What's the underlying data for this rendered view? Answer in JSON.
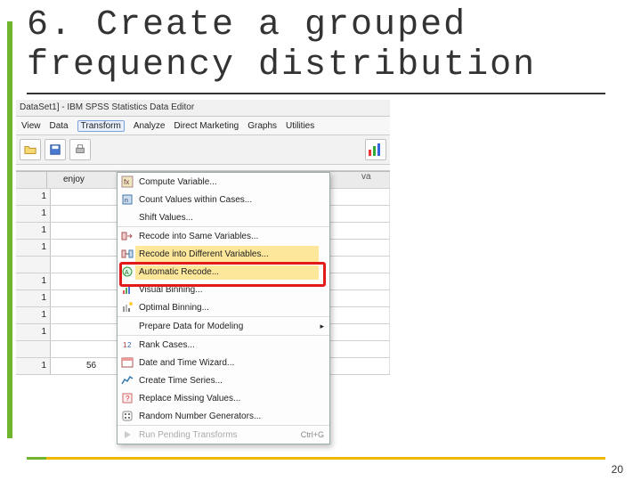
{
  "title": "6. Create a grouped frequency distribution",
  "page_number": "20",
  "app": {
    "title_bar": "DataSet1] - IBM SPSS Statistics Data Editor",
    "menubar": [
      "View",
      "Data",
      "Transform",
      "Analyze",
      "Direct Marketing",
      "Graphs",
      "Utilities"
    ],
    "active_menu_index": 2,
    "col_header_left": "enjoy",
    "col_header_right": "va",
    "rowheads": [
      "1",
      "1",
      "1",
      "1",
      "",
      "1",
      "1",
      "1",
      "1",
      "",
      "1"
    ],
    "bottom_cell": "56",
    "transform_menu": [
      {
        "icon": "compute",
        "label": "Compute Variable..."
      },
      {
        "icon": "count",
        "label": "Count Values within Cases..."
      },
      {
        "icon": "",
        "label": "Shift Values...",
        "sep": true
      },
      {
        "icon": "recode-same",
        "label": "Recode into Same Variables..."
      },
      {
        "icon": "recode-diff",
        "label": "Recode into Different Variables...",
        "highlight": true
      },
      {
        "icon": "auto",
        "label": "Automatic Recode..."
      },
      {
        "icon": "visual",
        "label": "Visual Binning..."
      },
      {
        "icon": "optimal",
        "label": "Optimal Binning...",
        "sep": true
      },
      {
        "icon": "",
        "label": "Prepare Data for Modeling",
        "sep": true,
        "submenu": true
      },
      {
        "icon": "rank",
        "label": "Rank Cases..."
      },
      {
        "icon": "date",
        "label": "Date and Time Wizard..."
      },
      {
        "icon": "series",
        "label": "Create Time Series..."
      },
      {
        "icon": "replace",
        "label": "Replace Missing Values..."
      },
      {
        "icon": "random",
        "label": "Random Number Generators...",
        "sep": true
      },
      {
        "icon": "run",
        "label": "Run Pending Transforms",
        "shortcut": "Ctrl+G",
        "disabled": true
      }
    ]
  }
}
